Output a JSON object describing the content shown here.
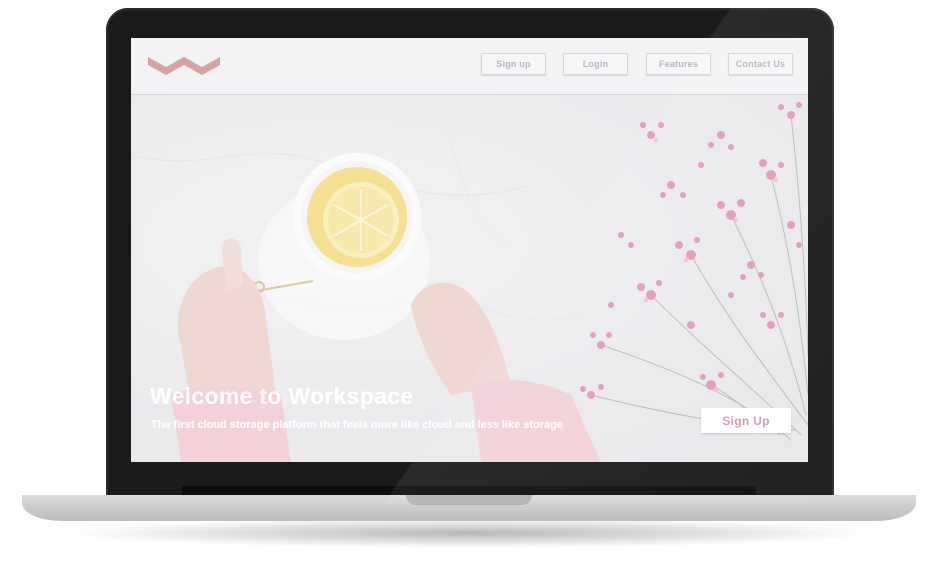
{
  "brand": {
    "logo_icon": "zigzag-logo-icon",
    "logo_color": "#d4a3a3"
  },
  "nav": {
    "items": [
      {
        "label": "Sign up"
      },
      {
        "label": "Login"
      },
      {
        "label": "Features"
      },
      {
        "label": "Contact Us"
      }
    ]
  },
  "hero": {
    "title": "Welcome to Workspace",
    "subtitle": "The first cloud storage platform that feels more like cloud and less like storage",
    "cta_label": "Sign Up",
    "cta_color": "#d39aa3"
  },
  "colors": {
    "navbar_bg": "#f3f3f5",
    "hero_overlay": "#e6e6ea",
    "text_light": "#ffffff",
    "flower_pink": "#d66a9b",
    "tea_yellow": "#f2d060"
  }
}
